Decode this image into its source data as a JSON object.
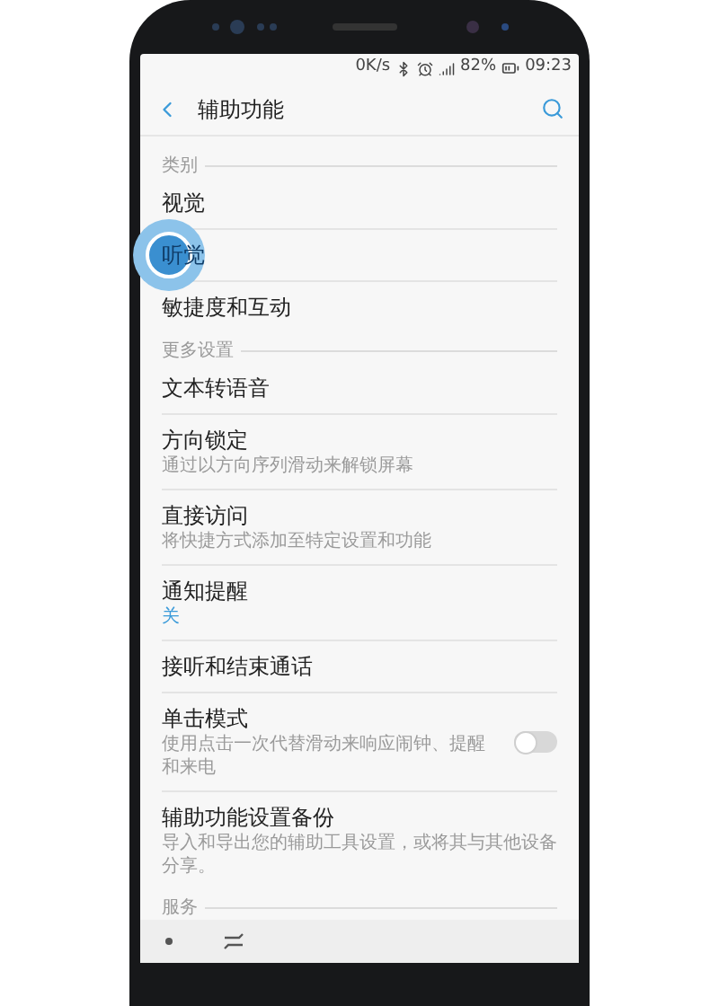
{
  "status_bar": {
    "speed": "0K/s",
    "battery": "82%",
    "time": "09:23"
  },
  "header": {
    "title": "辅助功能"
  },
  "sections": [
    {
      "title": "类别",
      "items": [
        {
          "kind": "plain",
          "label": "视觉",
          "touched": false
        },
        {
          "kind": "plain",
          "label": "听觉",
          "touched": true
        },
        {
          "kind": "plain",
          "label": "敏捷度和互动",
          "touched": false
        }
      ]
    },
    {
      "title": "更多设置",
      "items": [
        {
          "kind": "plain",
          "label": "文本转语音",
          "touched": false
        },
        {
          "kind": "plain",
          "label": "方向锁定",
          "subtitle": "通过以方向序列滑动来解锁屏幕",
          "touched": false
        },
        {
          "kind": "plain",
          "label": "直接访问",
          "subtitle": "将快捷方式添加至特定设置和功能",
          "touched": false
        },
        {
          "kind": "value",
          "label": "通知提醒",
          "value": "关",
          "touched": false
        },
        {
          "kind": "plain",
          "label": "接听和结束通话",
          "touched": false
        },
        {
          "kind": "toggle",
          "label": "单击模式",
          "subtitle": "使用点击一次代替滑动来响应闹钟、提醒和来电",
          "on": false,
          "touched": false
        },
        {
          "kind": "plain",
          "label": "辅助功能设置备份",
          "subtitle": "导入和导出您的辅助工具设置，或将其与其他设备分享。",
          "touched": false
        }
      ]
    },
    {
      "title": "服务"
    }
  ]
}
